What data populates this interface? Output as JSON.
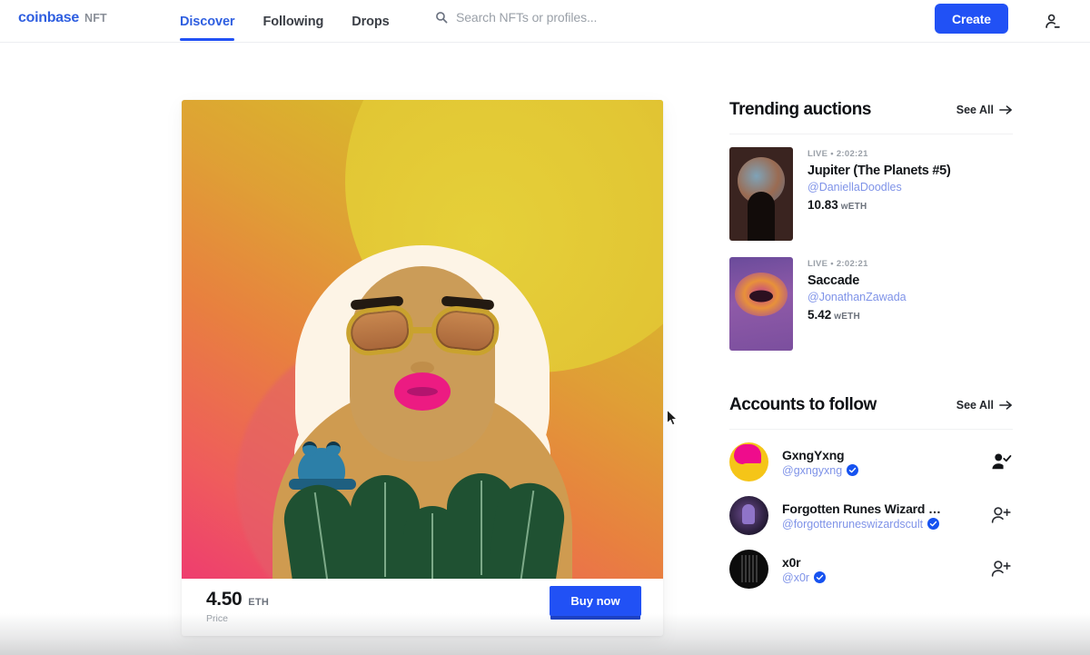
{
  "header": {
    "brand_primary": "coinbase",
    "brand_secondary": "NFT",
    "nav": [
      {
        "label": "Discover",
        "active": true
      },
      {
        "label": "Following",
        "active": false
      },
      {
        "label": "Drops",
        "active": false
      }
    ],
    "search": {
      "placeholder": "Search NFTs or profiles...",
      "value": "",
      "icon": "search-icon"
    },
    "create_label": "Create",
    "avatar_icon": "user-avatar-icon"
  },
  "featured_card": {
    "artwork_alt": "Illustrated portrait of a woman with platinum curly hair, leopard print cat-eye sunglasses, pink lips, a blue frog on her shoulder, gold dotted necklace and a green leaf top on an orange-to-yellow gradient background",
    "price_value": "4.50",
    "price_currency": "ETH",
    "price_label": "Price",
    "buy_label": "Buy now"
  },
  "trending": {
    "title": "Trending auctions",
    "see_all": "See All",
    "items": [
      {
        "live_label": "LIVE • 2:02:21",
        "name": "Jupiter (The Planets #5)",
        "creator": "@DaniellaDoodles",
        "price": "10.83",
        "currency": "wETH",
        "thumb": "jupiter-planet-thumbnail"
      },
      {
        "live_label": "LIVE • 2:02:21",
        "name": "Saccade",
        "creator": "@JonathanZawada",
        "price": "5.42",
        "currency": "wETH",
        "thumb": "saccade-eye-mouth-thumbnail"
      }
    ]
  },
  "accounts": {
    "title": "Accounts to follow",
    "see_all": "See All",
    "items": [
      {
        "name": "GxngYxng",
        "handle": "@gxngyxng",
        "verified": true,
        "action_icon": "person-check-icon",
        "following": true
      },
      {
        "name": "Forgotten Runes Wizard C...",
        "handle": "@forgottenruneswizardscult",
        "verified": true,
        "action_icon": "person-plus-icon",
        "following": false
      },
      {
        "name": "x0r",
        "handle": "@x0r",
        "verified": true,
        "action_icon": "person-plus-icon",
        "following": false
      }
    ]
  },
  "colors": {
    "accent_blue": "#2151f5",
    "brand_blue": "#2f5fe0",
    "link_blue": "#7f93e8",
    "verified_blue": "#1652f0",
    "text_primary": "#13161a",
    "text_muted": "#9aa0a8"
  }
}
